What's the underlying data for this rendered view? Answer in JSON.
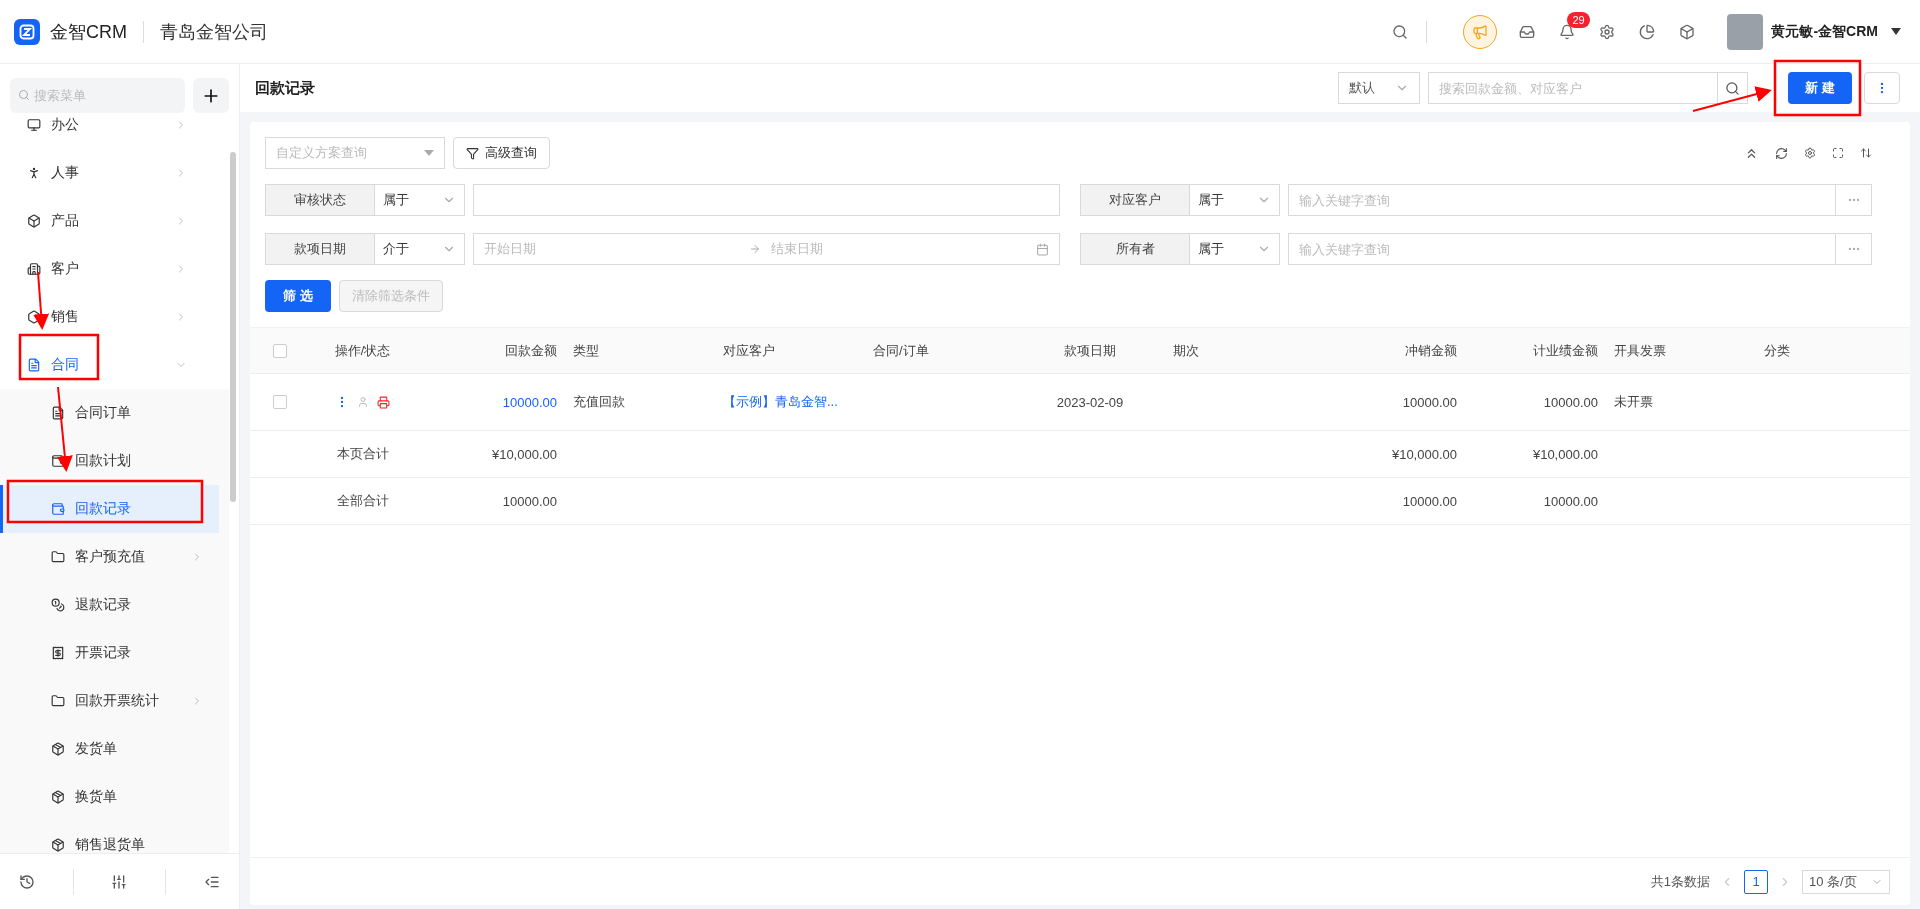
{
  "brand": {
    "name": "金智CRM",
    "company": "青岛金智公司"
  },
  "header": {
    "notification_count": "29",
    "user": "黄元敏-金智CRM"
  },
  "sidebar": {
    "search_placeholder": "搜索菜单",
    "items": [
      {
        "label": "办公",
        "expanded": false,
        "selected": false
      },
      {
        "label": "人事",
        "expanded": false,
        "selected": false
      },
      {
        "label": "产品",
        "expanded": false,
        "selected": false
      },
      {
        "label": "客户",
        "expanded": false,
        "selected": false
      },
      {
        "label": "销售",
        "expanded": false,
        "selected": false
      },
      {
        "label": "合同",
        "expanded": true,
        "selected": true,
        "children": [
          {
            "label": "合同订单",
            "selected": false
          },
          {
            "label": "回款计划",
            "selected": false
          },
          {
            "label": "回款记录",
            "selected": true
          },
          {
            "label": "客户预充值",
            "expanded": false,
            "selected": false
          },
          {
            "label": "退款记录",
            "selected": false
          },
          {
            "label": "开票记录",
            "selected": false
          },
          {
            "label": "回款开票统计",
            "expanded": false,
            "selected": false
          },
          {
            "label": "发货单",
            "selected": false
          },
          {
            "label": "换货单",
            "selected": false
          },
          {
            "label": "销售退货单",
            "selected": false
          }
        ]
      }
    ]
  },
  "page": {
    "title": "回款记录",
    "view": "默认",
    "search_placeholder": "搜索回款金额、对应客户",
    "new_button": "新 建"
  },
  "filters": {
    "scheme_placeholder": "自定义方案查询",
    "advanced": "高级查询",
    "conditions": [
      {
        "kind": "text",
        "label": "审核状态",
        "operator": "属于"
      },
      {
        "kind": "keyword",
        "label": "对应客户",
        "operator": "属于",
        "placeholder": "输入关键字查询"
      },
      {
        "kind": "date-range",
        "label": "款项日期",
        "operator": "介于",
        "start_placeholder": "开始日期",
        "end_placeholder": "结束日期"
      },
      {
        "kind": "keyword",
        "label": "所有者",
        "operator": "属于",
        "placeholder": "输入关键字查询"
      }
    ],
    "apply": "筛 选",
    "clear": {
      "label": "清除筛选条件",
      "disabled": true
    }
  },
  "table": {
    "select_all": {
      "checked": false
    },
    "columns": [
      "操作/状态",
      "回款金额",
      "类型",
      "对应客户",
      "合同/订单",
      "款项日期",
      "期次",
      "冲销金额",
      "计业绩金额",
      "开具发票",
      "分类"
    ],
    "rows": [
      {
        "checked": false,
        "amount": "10000.00",
        "type": "充值回款",
        "customer": "【示例】青岛金智...",
        "date": "2023-02-09",
        "writeoff": "10000.00",
        "performance": "10000.00",
        "invoice": "未开票"
      }
    ],
    "totals": [
      {
        "label": "本页合计",
        "amount": "¥10,000.00",
        "writeoff": "¥10,000.00",
        "performance": "¥10,000.00"
      },
      {
        "label": "全部合计",
        "amount": "10000.00",
        "writeoff": "10000.00",
        "performance": "10000.00"
      }
    ]
  },
  "pagination": {
    "total": "共1条数据",
    "pages": [
      {
        "label": "1",
        "selected": true
      }
    ],
    "page_size": "10 条/页"
  }
}
